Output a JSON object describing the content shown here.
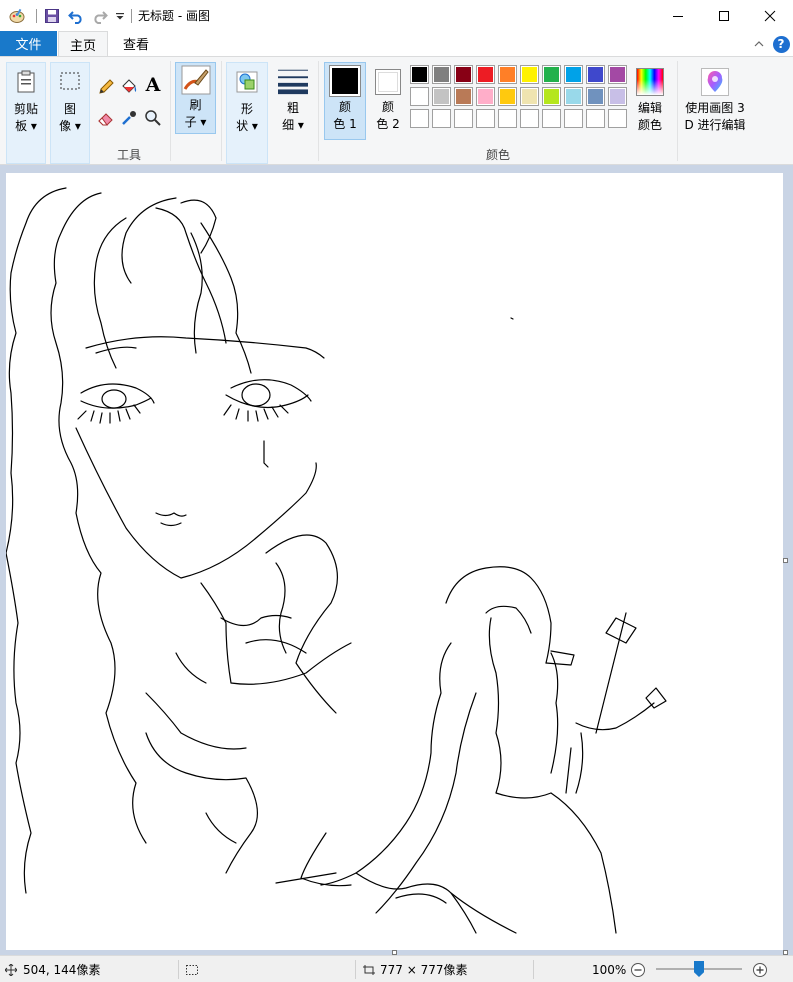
{
  "window": {
    "title": "无标题 - 画图",
    "controls": {
      "minimize_icon": "minimize-icon",
      "maximize_icon": "maximize-icon",
      "close_icon": "close-icon"
    }
  },
  "quick_access": {
    "app_icon": "paint-palette-icon",
    "save_icon": "save-icon",
    "undo_icon": "undo-icon",
    "redo_icon": "redo-icon",
    "customize_icon": "chevron-down-icon"
  },
  "tabs": {
    "file": "文件",
    "home": "主页",
    "view": "查看",
    "collapse_icon": "chevron-up-icon",
    "help_label": "?"
  },
  "ribbon": {
    "clipboard": {
      "line1": "剪贴",
      "line2": "板 ▾"
    },
    "image": {
      "line1": "图",
      "line2": "像 ▾"
    },
    "tools": {
      "group_label": "工具",
      "text_tool": "A"
    },
    "brushes": {
      "line1": "刷",
      "line2": "子 ▾"
    },
    "shapes": {
      "line1": "形",
      "line2": "状 ▾"
    },
    "size": {
      "line1": "粗",
      "line2": "细 ▾"
    },
    "color1": {
      "line1": "颜",
      "line2": "色 1",
      "value": "#000000"
    },
    "color2": {
      "line1": "颜",
      "line2": "色 2",
      "value": "#ffffff"
    },
    "colors_group_label": "颜色",
    "edit_colors": {
      "line1": "编辑",
      "line2": "颜色"
    },
    "paint3d": {
      "line1": "使用画图 3",
      "line2": "D 进行编辑"
    },
    "palette_row1": [
      "#000000",
      "#7f7f7f",
      "#880015",
      "#ed1c24",
      "#ff7f27",
      "#fff200",
      "#22b14c",
      "#00a2e8",
      "#3f48cc",
      "#a349a4"
    ],
    "palette_row2": [
      "#ffffff",
      "#c3c3c3",
      "#b97a57",
      "#ffaec9",
      "#ffc90e",
      "#efe4b0",
      "#b5e61d",
      "#99d9ea",
      "#7092be",
      "#c8bfe7"
    ],
    "palette_row3": [
      "#ffffff",
      "#ffffff",
      "#ffffff",
      "#ffffff",
      "#ffffff",
      "#ffffff",
      "#ffffff",
      "#ffffff",
      "#ffffff",
      "#ffffff"
    ]
  },
  "status": {
    "cursor_pos": "504, 144像素",
    "canvas_size": "777 × 777像素",
    "zoom": "100%",
    "zoom_level": 0.5
  }
}
